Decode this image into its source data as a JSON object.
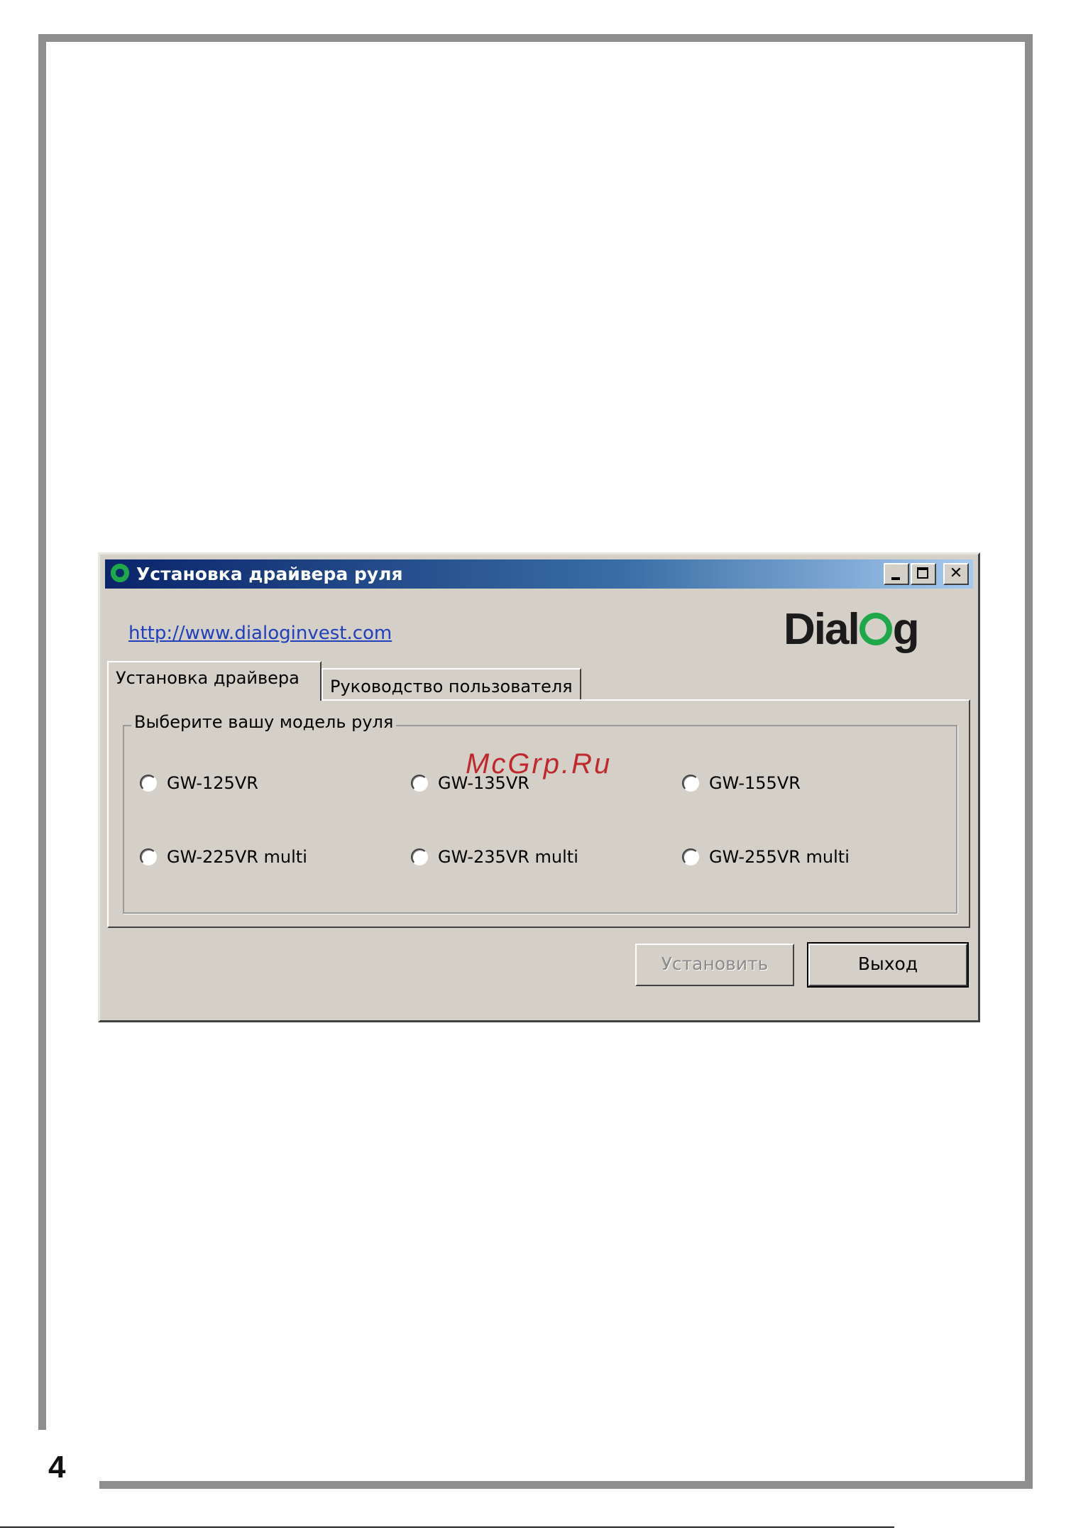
{
  "page": {
    "number": "4"
  },
  "watermark": "McGrp.Ru",
  "window": {
    "title": "Установка драйвера руля",
    "icon": "dialog-app-icon",
    "controls": {
      "minimize": "minimize-icon",
      "maximize": "maximize-icon",
      "close": "✕"
    }
  },
  "header": {
    "link": "http://www.dialoginvest.com",
    "logo": {
      "text_before": "Dial",
      "text_after": "g",
      "color_o": "#1ea84a"
    }
  },
  "tabs": [
    {
      "label": "Установка драйвера",
      "active": true
    },
    {
      "label": "Руководство пользователя",
      "active": false
    }
  ],
  "model_group": {
    "label": "Выберите вашу модель руля",
    "options": [
      {
        "label": "GW-125VR",
        "checked": false
      },
      {
        "label": "GW-135VR",
        "checked": false
      },
      {
        "label": "GW-155VR",
        "checked": false
      },
      {
        "label": "GW-225VR multi",
        "checked": false
      },
      {
        "label": "GW-235VR multi",
        "checked": false
      },
      {
        "label": "GW-255VR multi",
        "checked": false
      }
    ]
  },
  "buttons": {
    "install": {
      "label": "Установить",
      "enabled": false
    },
    "exit": {
      "label": "Выход",
      "enabled": true
    }
  }
}
